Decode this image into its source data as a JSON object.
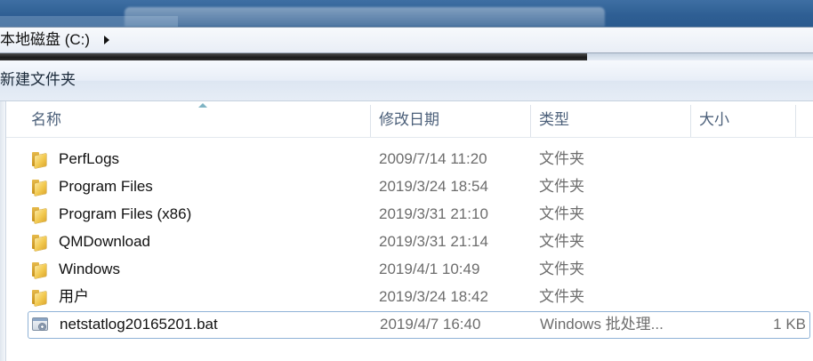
{
  "address_bar": {
    "path": "本地磁盘 (C:)"
  },
  "toolbar": {
    "new_folder_label": "新建文件夹"
  },
  "columns": {
    "name": "名称",
    "date": "修改日期",
    "type": "类型",
    "size": "大小"
  },
  "files": [
    {
      "name": "PerfLogs",
      "date": "2009/7/14 11:20",
      "type": "文件夹",
      "size": "",
      "icon": "folder-icon"
    },
    {
      "name": "Program Files",
      "date": "2019/3/24 18:54",
      "type": "文件夹",
      "size": "",
      "icon": "folder-icon"
    },
    {
      "name": "Program Files (x86)",
      "date": "2019/3/31 21:10",
      "type": "文件夹",
      "size": "",
      "icon": "folder-icon"
    },
    {
      "name": "QMDownload",
      "date": "2019/3/31 21:14",
      "type": "文件夹",
      "size": "",
      "icon": "folder-icon"
    },
    {
      "name": "Windows",
      "date": "2019/4/1 10:49",
      "type": "文件夹",
      "size": "",
      "icon": "folder-icon"
    },
    {
      "name": "用户",
      "date": "2019/3/24 18:42",
      "type": "文件夹",
      "size": "",
      "icon": "folder-icon"
    },
    {
      "name": "netstatlog20165201.bat",
      "date": "2019/4/7 16:40",
      "type": "Windows 批处理...",
      "size": "1 KB",
      "icon": "batch-file-icon",
      "selected": true
    }
  ],
  "colors": {
    "titlebar": "#2f5f94",
    "selection_border": "#8fb2d6",
    "header_text": "#4c607a",
    "secondary_text": "#6d6d6d"
  }
}
